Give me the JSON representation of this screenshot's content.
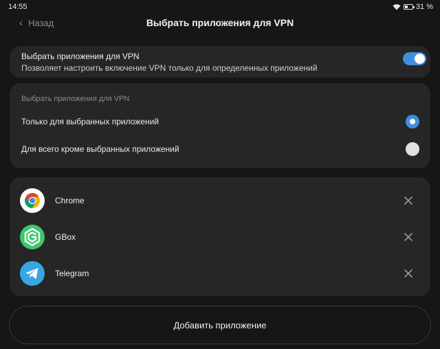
{
  "status_bar": {
    "time": "14:55",
    "battery": "31 %",
    "wifi_icon": "wifi-icon",
    "battery_icon": "battery-icon"
  },
  "header": {
    "back_label": "Назад",
    "title": "Выбрать приложения для VPN"
  },
  "toggle_card": {
    "title": "Выбрать приложения для VPN",
    "subtitle": "Позволяет настроить включение VPN только для определенных приложений",
    "enabled": true
  },
  "mode_card": {
    "section_label": "Выбрать приложения для VPN",
    "options": [
      {
        "label": "Только для выбранных приложений",
        "selected": true
      },
      {
        "label": "Для всего кроме выбранных приложений",
        "selected": false
      }
    ]
  },
  "apps": [
    {
      "name": "Chrome",
      "icon": "chrome-icon"
    },
    {
      "name": "GBox",
      "icon": "gbox-icon"
    },
    {
      "name": "Telegram",
      "icon": "telegram-icon"
    }
  ],
  "add_button_label": "Добавить приложение",
  "colors": {
    "accent": "#3f8fe0",
    "background": "#161616",
    "card": "#262626"
  }
}
